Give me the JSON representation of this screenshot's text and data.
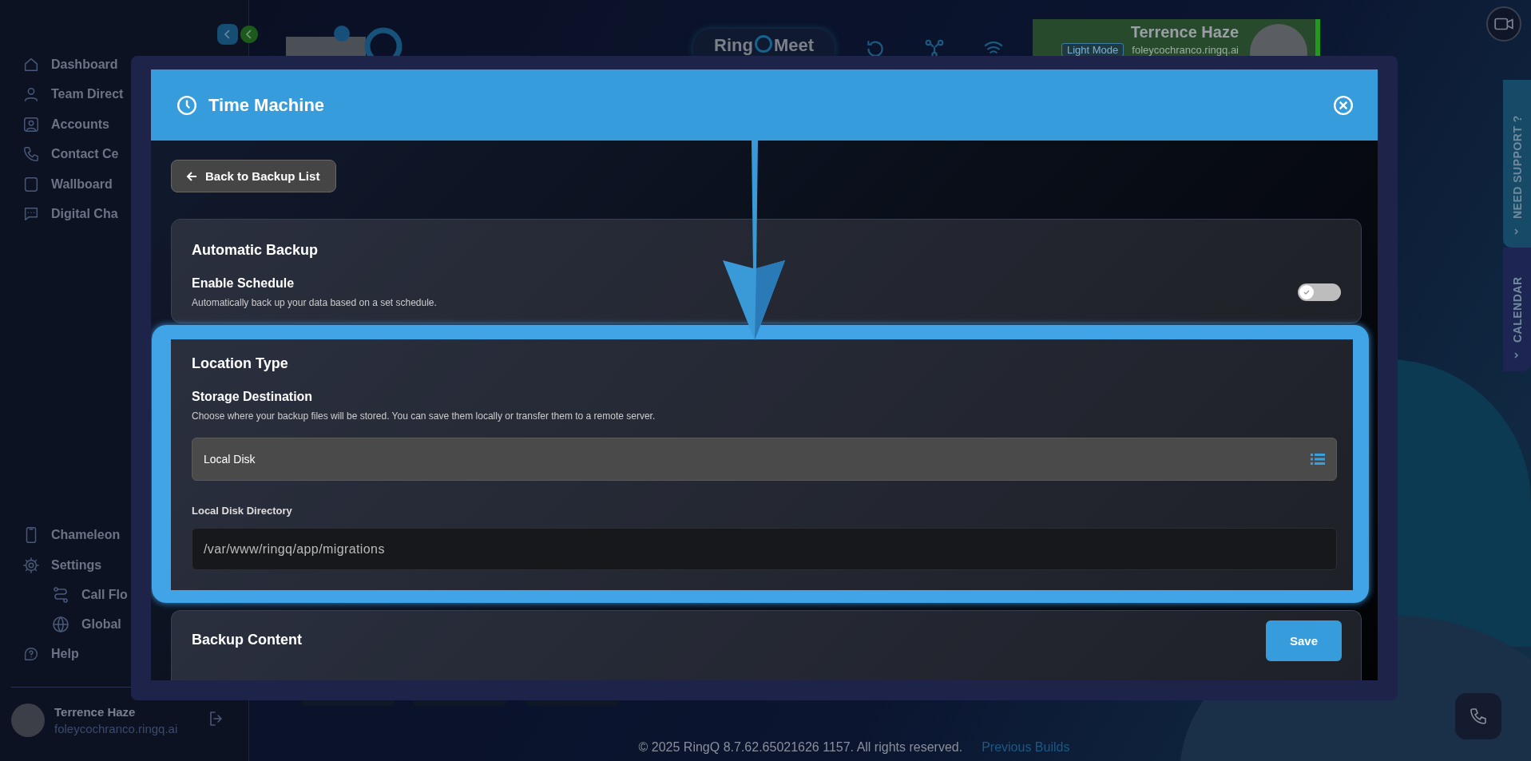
{
  "sidebar": {
    "items": [
      {
        "label": "Dashboard"
      },
      {
        "label": "Team Direct"
      },
      {
        "label": "Accounts"
      },
      {
        "label": "Contact Ce"
      },
      {
        "label": "Wallboard"
      },
      {
        "label": "Digital Cha"
      }
    ],
    "bottom_items": [
      {
        "label": "Chameleon"
      },
      {
        "label": "Settings",
        "children": [
          {
            "label": "Call Flo"
          },
          {
            "label": "Global"
          }
        ]
      },
      {
        "label": "Help"
      }
    ],
    "user": {
      "name": "Terrence Haze",
      "domain": "foleycochranco.ringq.ai"
    }
  },
  "header": {
    "meet_logo": {
      "left": "Ring",
      "right": "Meet"
    },
    "profile": {
      "name": "Terrence Haze",
      "badge": "Light Mode",
      "domain": "foleycochranco.ringq.ai"
    }
  },
  "side_tabs": [
    {
      "label": "NEED SUPPORT ?"
    },
    {
      "label": "CALENDAR"
    }
  ],
  "modal": {
    "title": "Time Machine",
    "back_button": "Back to Backup List",
    "sections": [
      {
        "title": "Automatic Backup",
        "highlighted": false,
        "fields": [
          {
            "kind": "toggle",
            "label": "Enable Schedule",
            "description": "Automatically back up your data based on a set schedule.",
            "on": false
          }
        ]
      },
      {
        "title": "Location Type",
        "highlighted": true,
        "fields": [
          {
            "kind": "select",
            "label": "Storage Destination",
            "description": "Choose where your backup files will be stored. You can save them locally or transfer them to a remote server.",
            "value": "Local Disk"
          },
          {
            "kind": "text",
            "label": "Local Disk Directory",
            "value": "/var/www/ringq/app/migrations"
          }
        ]
      },
      {
        "title": "Backup Content",
        "highlighted": false
      }
    ],
    "save_button": "Save"
  },
  "footer": {
    "copyright": "© 2025 RingQ 8.7.62.65021626 1157. All rights reserved.",
    "link": "Previous Builds"
  }
}
